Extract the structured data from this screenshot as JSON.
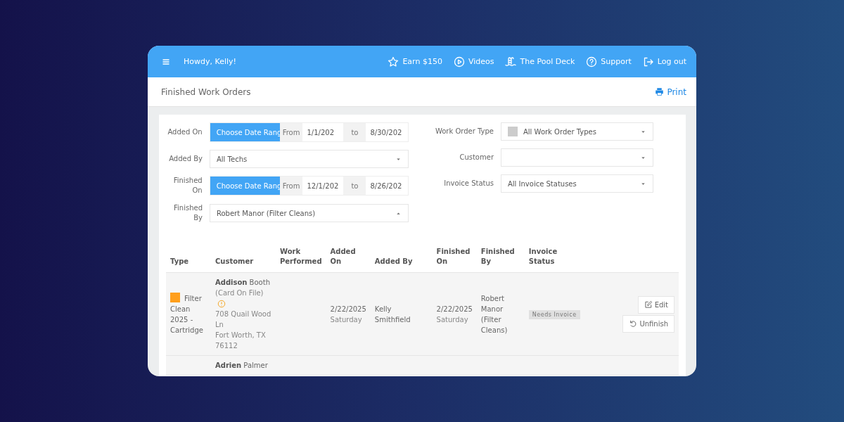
{
  "header": {
    "greeting": "Howdy, Kelly!",
    "links": [
      {
        "kind": "star",
        "label": "Earn $150"
      },
      {
        "kind": "play",
        "label": "Videos"
      },
      {
        "kind": "pool",
        "label": "The Pool Deck"
      },
      {
        "kind": "help",
        "label": "Support"
      },
      {
        "kind": "logout",
        "label": "Log out"
      }
    ]
  },
  "page": {
    "title": "Finished Work Orders",
    "print": "Print"
  },
  "filters_left": [
    {
      "kind": "daterange",
      "label": "Added On",
      "button": "Choose Date Rang",
      "from_label": "From",
      "from": "1/1/202",
      "to_label": "to",
      "to": "8/30/202"
    },
    {
      "kind": "select",
      "label": "Added By",
      "value": "All Techs",
      "open": false
    },
    {
      "kind": "daterange",
      "label": "Finished On",
      "button": "Choose Date Rang",
      "from_label": "From",
      "from": "12/1/202",
      "to_label": "to",
      "to": "8/26/202"
    },
    {
      "kind": "select",
      "label": "Finished By",
      "value": "Robert Manor (Filter Cleans)",
      "open": true
    }
  ],
  "filters_right": [
    {
      "kind": "select",
      "label": "Work Order Type",
      "value": "All Work Order Types",
      "swatch": true,
      "open": false
    },
    {
      "kind": "select",
      "label": "Customer",
      "open": false
    },
    {
      "kind": "select",
      "label": "Invoice Status",
      "value": "All Invoice Statuses",
      "open": false
    }
  ],
  "table": {
    "columns": [
      "Type",
      "Customer",
      "Work Performed",
      "Added On",
      "Added By",
      "Finished On",
      "Finished By",
      "Invoice Status"
    ],
    "rows": [
      {
        "type": "Filter Clean 2025 - Cartridge",
        "color": "#ff9f1c",
        "customer": "**Addison** Booth",
        "customer_note": "(Card On File)",
        "warning": true,
        "address": [
          "708 Quail Wood Ln",
          "Fort Worth, TX 76112"
        ],
        "added_on": "2/22/2025",
        "added_day": "Saturday",
        "added_by": "Kelly Smithfield",
        "finished_on": "2/22/2025",
        "finished_day": "Saturday",
        "finished_by": "Robert Manor (Filter Cleans)",
        "invoice_status": "Needs Invoice",
        "actions": [
          {
            "kind": "edit",
            "label": "Edit"
          },
          {
            "kind": "undo",
            "label": "Unfinish"
          }
        ]
      },
      {
        "customer": "**Adrien** Palmer"
      }
    ]
  }
}
